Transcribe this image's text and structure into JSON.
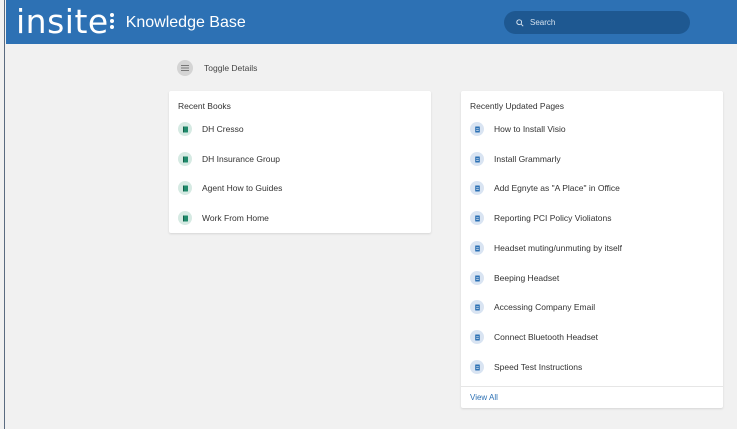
{
  "header": {
    "logo_text": "insite",
    "title": "Knowledge Base",
    "search_placeholder": "Search",
    "brand_color": "#2d71b4"
  },
  "toggle": {
    "label": "Toggle Details"
  },
  "recent_books": {
    "title": "Recent Books",
    "items": [
      {
        "label": "DH Cresso",
        "icon": "book-icon"
      },
      {
        "label": "DH Insurance Group",
        "icon": "book-icon"
      },
      {
        "label": "Agent How to Guides",
        "icon": "book-icon"
      },
      {
        "label": "Work From Home",
        "icon": "book-icon"
      }
    ]
  },
  "recent_pages": {
    "title": "Recently Updated Pages",
    "items": [
      {
        "label": "How to Install Visio",
        "icon": "page-icon"
      },
      {
        "label": "Install Grammarly",
        "icon": "page-icon"
      },
      {
        "label": "Add Egnyte as \"A Place\" in Office",
        "icon": "page-icon"
      },
      {
        "label": "Reporting PCI Policy Violiatons",
        "icon": "page-icon"
      },
      {
        "label": "Headset muting/unmuting by itself",
        "icon": "page-icon"
      },
      {
        "label": "Beeping Headset",
        "icon": "page-icon"
      },
      {
        "label": "Accessing Company Email",
        "icon": "page-icon"
      },
      {
        "label": "Connect Bluetooth Headset",
        "icon": "page-icon"
      },
      {
        "label": "Speed Test Instructions",
        "icon": "page-icon"
      }
    ],
    "view_all_label": "View All"
  }
}
